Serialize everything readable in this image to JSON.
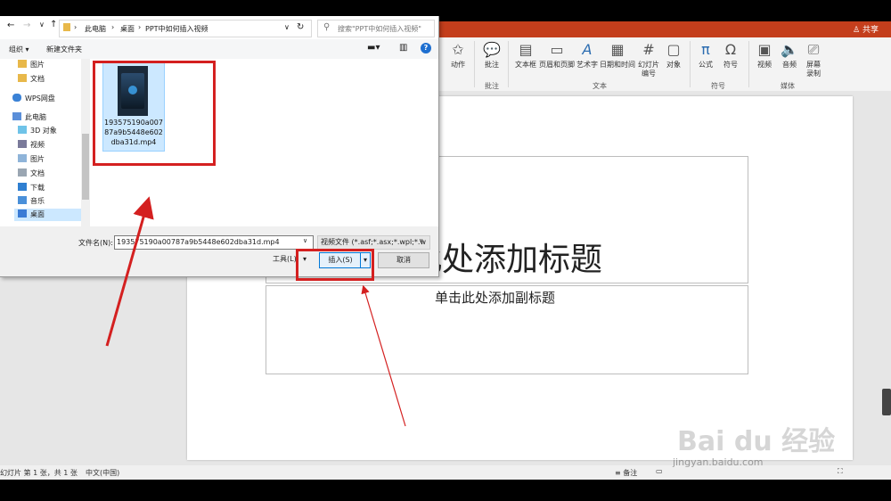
{
  "ppt": {
    "share": "共享",
    "ribbon": {
      "buttons": [
        {
          "label": "动作",
          "icon": "star-icon"
        },
        {
          "label": "批注",
          "icon": "comment-icon"
        },
        {
          "label": "文本框",
          "icon": "textbox-icon"
        },
        {
          "label": "页眉和页脚",
          "icon": "header-footer-icon"
        },
        {
          "label": "艺术字",
          "icon": "wordart-icon"
        },
        {
          "label": "日期和时间",
          "icon": "calendar-icon"
        },
        {
          "label": "幻灯片\n编号",
          "icon": "slide-number-icon"
        },
        {
          "label": "对象",
          "icon": "object-icon"
        },
        {
          "label": "公式",
          "icon": "equation-icon"
        },
        {
          "label": "符号",
          "icon": "omega-icon"
        },
        {
          "label": "视频",
          "icon": "video-icon"
        },
        {
          "label": "音频",
          "icon": "audio-icon"
        },
        {
          "label": "屏幕\n录制",
          "icon": "screen-record-icon"
        }
      ],
      "groups": {
        "comments": "批注",
        "text": "文本",
        "symbols": "符号",
        "media": "媒体"
      }
    },
    "slide": {
      "title_placeholder": "此处添加标题",
      "subtitle_placeholder": "单击此处添加副标题"
    },
    "status": {
      "slide_info": "幻灯片 第 1 张，共 1 张",
      "language": "中文(中国)",
      "notes": "备注"
    }
  },
  "dialog": {
    "breadcrumb": [
      "此电脑",
      "桌面",
      "PPT中如何插入视频"
    ],
    "search_placeholder": "搜索\"PPT中如何插入视频\"",
    "organize": "组织 ▾",
    "new_folder": "新建文件夹",
    "nav": [
      {
        "label": "图片",
        "icon": "folder-icon",
        "indent": 1
      },
      {
        "label": "文档",
        "icon": "folder-icon",
        "indent": 1
      },
      {
        "label": "WPS网盘",
        "icon": "cloud-icon",
        "indent": 0
      },
      {
        "label": "此电脑",
        "icon": "computer-icon",
        "indent": 0
      },
      {
        "label": "3D 对象",
        "icon": "cube-icon",
        "indent": 1
      },
      {
        "label": "视频",
        "icon": "video-folder-icon",
        "indent": 1
      },
      {
        "label": "图片",
        "icon": "pictures-folder-icon",
        "indent": 1
      },
      {
        "label": "文档",
        "icon": "documents-folder-icon",
        "indent": 1
      },
      {
        "label": "下载",
        "icon": "download-icon",
        "indent": 1
      },
      {
        "label": "音乐",
        "icon": "music-icon",
        "indent": 1
      },
      {
        "label": "桌面",
        "icon": "desktop-icon",
        "indent": 1,
        "selected": true
      }
    ],
    "file": {
      "name": "193575190a00787a9b5448e602dba31d.mp4"
    },
    "filename_label": "文件名(N):",
    "filename_value": "193575190a00787a9b5448e602dba31d.mp4",
    "filetype": "视频文件 (*.asf;*.asx;*.wpl;*.w",
    "tools": "工具(L)",
    "insert": "插入(S)",
    "cancel": "取消"
  },
  "watermark": {
    "brand": "Bai du 经验",
    "url": "jingyan.baidu.com"
  },
  "colors": {
    "accent": "#c43e1c",
    "highlight": "#d42020",
    "selection": "#cce8ff"
  }
}
